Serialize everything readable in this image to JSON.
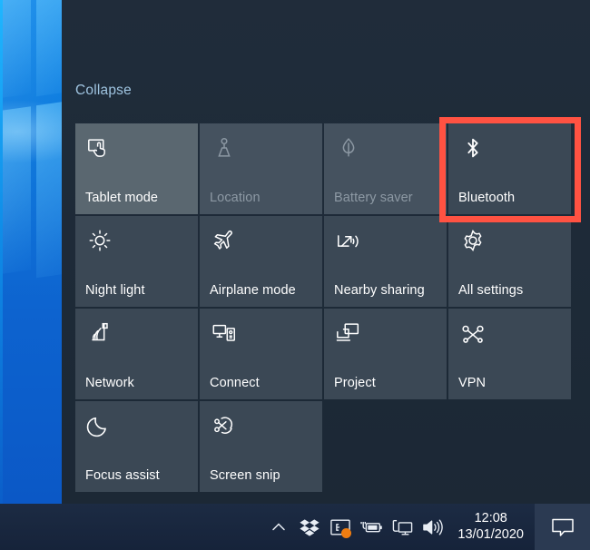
{
  "desktop": {
    "wallpaper_name": "windows-10-hero-wallpaper"
  },
  "action_center": {
    "collapse_label": "Collapse",
    "panel_color": "#1d2a38",
    "tiles": [
      [
        {
          "label": "Tablet mode",
          "icon": "tablet-mode-icon",
          "state": "on"
        },
        {
          "label": "Location",
          "icon": "location-icon",
          "state": "disabled"
        },
        {
          "label": "Battery saver",
          "icon": "battery-saver-icon",
          "state": "disabled"
        },
        {
          "label": "Bluetooth",
          "icon": "bluetooth-icon",
          "state": "off"
        }
      ],
      [
        {
          "label": "Night light",
          "icon": "night-light-icon",
          "state": "off"
        },
        {
          "label": "Airplane mode",
          "icon": "airplane-mode-icon",
          "state": "off"
        },
        {
          "label": "Nearby sharing",
          "icon": "nearby-sharing-icon",
          "state": "off"
        },
        {
          "label": "All settings",
          "icon": "gear-icon",
          "state": "off"
        }
      ],
      [
        {
          "label": "Network",
          "icon": "network-icon",
          "state": "off"
        },
        {
          "label": "Connect",
          "icon": "connect-icon",
          "state": "off"
        },
        {
          "label": "Project",
          "icon": "project-icon",
          "state": "off"
        },
        {
          "label": "VPN",
          "icon": "vpn-icon",
          "state": "off"
        }
      ],
      [
        {
          "label": "Focus assist",
          "icon": "moon-icon",
          "state": "off"
        },
        {
          "label": "Screen snip",
          "icon": "screen-snip-icon",
          "state": "off"
        },
        {
          "label": "",
          "icon": "",
          "state": "empty"
        },
        {
          "label": "",
          "icon": "",
          "state": "empty"
        }
      ]
    ]
  },
  "highlight": {
    "target": "Bluetooth",
    "color": "#ff5242"
  },
  "taskbar": {
    "tray_icons": [
      {
        "name": "show-hidden-icons-chevron-icon"
      },
      {
        "name": "dropbox-icon"
      },
      {
        "name": "screenshot-tool-icon",
        "badge": true
      },
      {
        "name": "battery-charging-icon"
      },
      {
        "name": "network-connection-icon"
      },
      {
        "name": "volume-speaker-icon"
      }
    ],
    "clock": {
      "time": "12:08",
      "date": "13/01/2020"
    },
    "action_center_icon": "action-center-speech-bubble-icon"
  }
}
